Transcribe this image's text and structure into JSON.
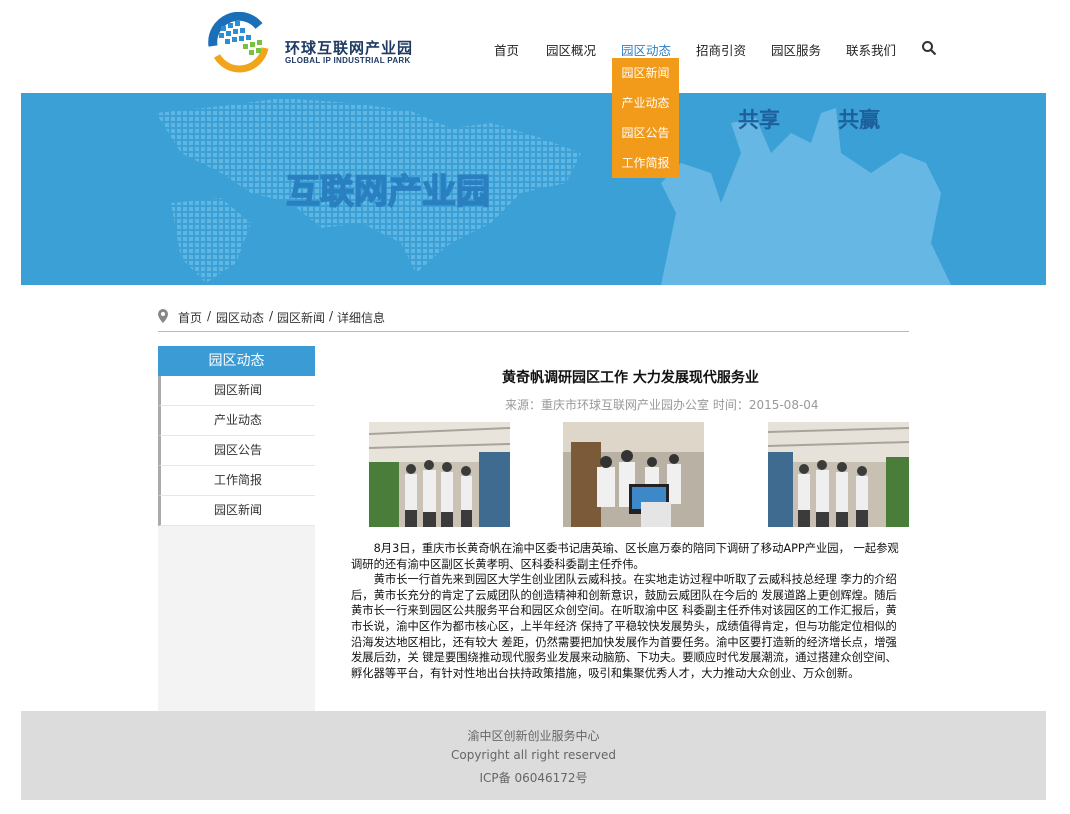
{
  "header": {
    "logo_cn": "环球互联网产业园",
    "logo_en": "GLOBAL IP INDUSTRIAL PARK"
  },
  "nav": {
    "items": [
      {
        "label": "首页"
      },
      {
        "label": "园区概况"
      },
      {
        "label": "园区动态"
      },
      {
        "label": "招商引资"
      },
      {
        "label": "园区服务"
      },
      {
        "label": "联系我们"
      }
    ],
    "active": "园区动态",
    "dropdown": [
      "园区新闻",
      "产业动态",
      "园区公告",
      "工作简报"
    ]
  },
  "banner": {
    "headline": "互联网产业园",
    "words": [
      "共享",
      "共赢"
    ]
  },
  "breadcrumb": [
    "首页",
    "园区动态",
    "园区新闻",
    "详细信息"
  ],
  "sidebar": {
    "title": "园区动态",
    "items": [
      "园区新闻",
      "产业动态",
      "园区公告",
      "工作简报",
      "园区新闻"
    ]
  },
  "article": {
    "title": "黄奇帆调研园区工作  大力发展现代服务业",
    "meta": "来源：重庆市环球互联网产业园办公室 时间：2015-08-04",
    "paragraphs": [
      "8月3日，重庆市长黄奇帆在渝中区委书记唐英瑜、区长扈万泰的陪同下调研了移动APP产业园， 一起参观调研的还有渝中区副区长黄孝明、区科委科委副主任乔伟。",
      "黄市长一行首先来到园区大学生创业团队云威科技。在实地走访过程中听取了云威科技总经理 李力的介绍后，黄市长充分的肯定了云威团队的创造精神和创新意识，鼓励云威团队在今后的 发展道路上更创辉煌。随后黄市长一行来到园区公共服务平台和园区众创空间。在听取渝中区 科委副主任乔伟对该园区的工作汇报后，黄市长说，渝中区作为都市核心区，上半年经济 保持了平稳较快发展势头，成绩值得肯定，但与功能定位相似的沿海发达地区相比，还有较大 差距，仍然需要把加快发展作为首要任务。渝中区要打造新的经济增长点，增强发展后劲，关 键是要围绕推动现代服务业发展来动脑筋、下功夫。要顺应时代发展潮流，通过搭建众创空间、 孵化器等平台，有针对性地出台扶持政策措施，吸引和集聚优秀人才，大力推动大众创业、万众创新。"
    ]
  },
  "footer": {
    "line1": "渝中区创新创业服务中心",
    "line2": "Copyright all right reserved",
    "line3": "ICP备 06046172号"
  },
  "colors": {
    "accent_blue": "#3a9bd5",
    "dropdown_orange": "#f29a1a",
    "banner_blue": "#3aa0d6",
    "footer_gray": "#dcdcdc"
  }
}
